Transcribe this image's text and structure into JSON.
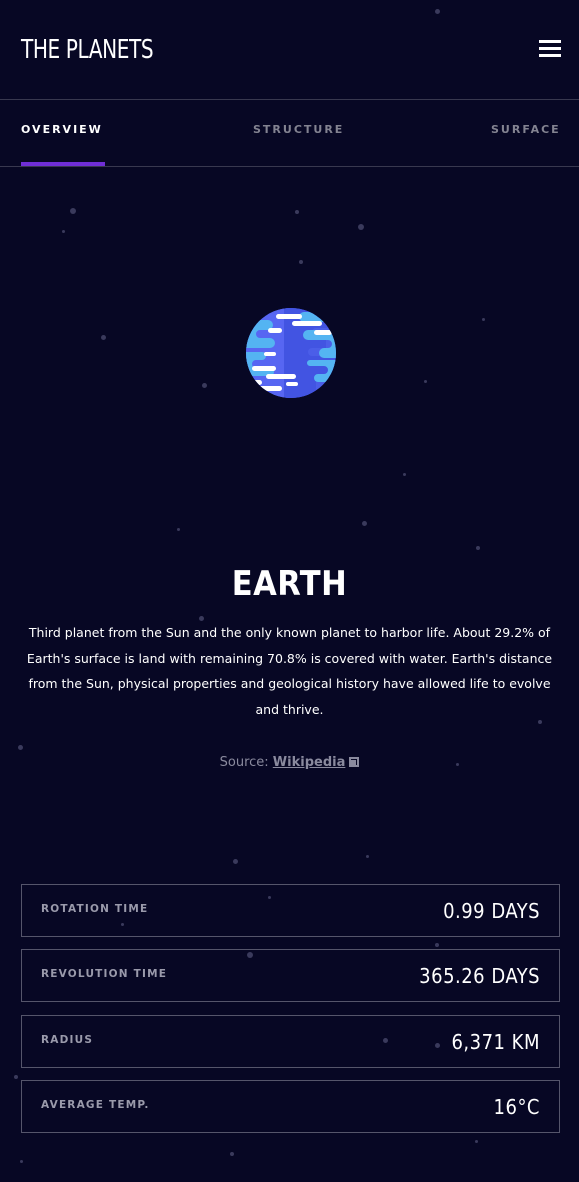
{
  "header": {
    "logo": "THE PLANETS",
    "menu_icon": "hamburger-menu-icon"
  },
  "tabs": [
    {
      "label": "OVERVIEW",
      "active": true
    },
    {
      "label": "STRUCTURE",
      "active": false
    },
    {
      "label": "SURFACE",
      "active": false
    }
  ],
  "planet": {
    "name": "EARTH",
    "description": "Third planet from the Sun and the only known planet to harbor life. About 29.2% of Earth's surface is land with remaining 70.8% is covered with water. Earth's distance from the Sun, physical properties and geological history have allowed life to evolve and thrive.",
    "source_label": "Source:",
    "source_link": "Wikipedia",
    "source_icon": "external-link-icon"
  },
  "stats": [
    {
      "label": "ROTATION TIME",
      "value": "0.99 DAYS"
    },
    {
      "label": "REVOLUTION TIME",
      "value": "365.26 DAYS"
    },
    {
      "label": "RADIUS",
      "value": "6,371 KM"
    },
    {
      "label": "AVERAGE TEMP.",
      "value": "16°C"
    }
  ],
  "colors": {
    "background": "#070724",
    "accent": "#6F2ED6",
    "border": "#38384F",
    "planet_blue": "#4E5DF0",
    "planet_cyan": "#4FB7F5"
  }
}
